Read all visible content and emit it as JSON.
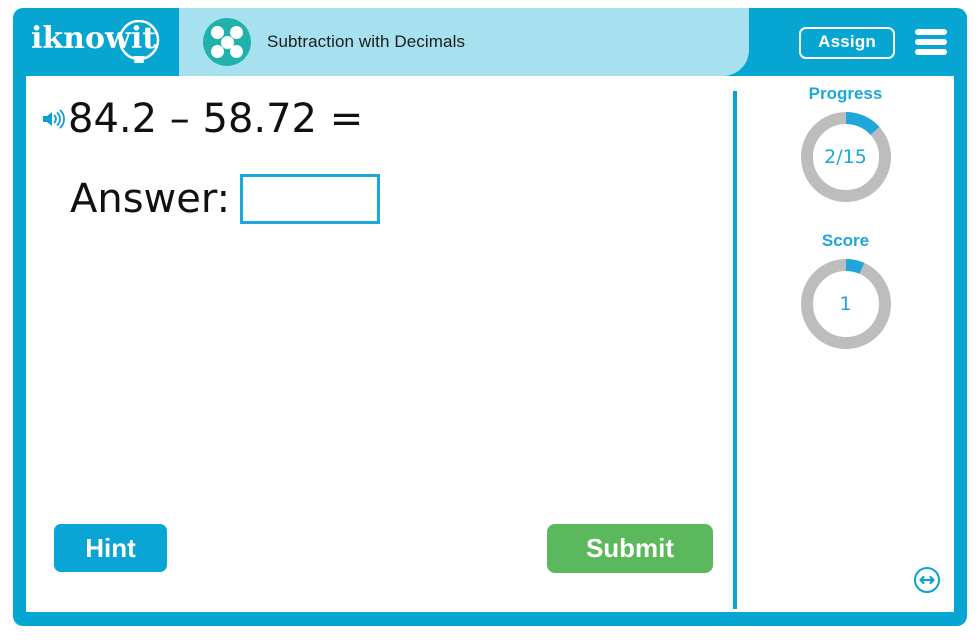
{
  "app": {
    "logo_text": "iknowit",
    "logo_icon": "lightbulb-icon",
    "frame_color": "#06a5d2"
  },
  "header": {
    "title": "Subtraction with Decimals",
    "subject_icon": "five-dots-circle-icon",
    "assign_label": "Assign",
    "menu_icon": "hamburger-menu-icon",
    "tab_color": "#a7e0ef"
  },
  "question": {
    "speaker_icon": "speaker-audio-icon",
    "text": "84.2 – 58.72 =",
    "answer_label": "Answer:",
    "answer_value": "",
    "answer_placeholder": ""
  },
  "actions": {
    "hint_label": "Hint",
    "submit_label": "Submit",
    "hint_color": "#09a5d4",
    "submit_color": "#5cb85c"
  },
  "sidebar": {
    "progress": {
      "label": "Progress",
      "value": "2/15",
      "current": 2,
      "total": 15,
      "percent": 13.3
    },
    "score": {
      "label": "Score",
      "value": "1",
      "current": 1,
      "total": 15,
      "percent": 6.7
    },
    "accent_color": "#1ea7d8",
    "track_color": "#bdbdbd",
    "resize_icon": "resize-horizontal-circle-icon"
  }
}
